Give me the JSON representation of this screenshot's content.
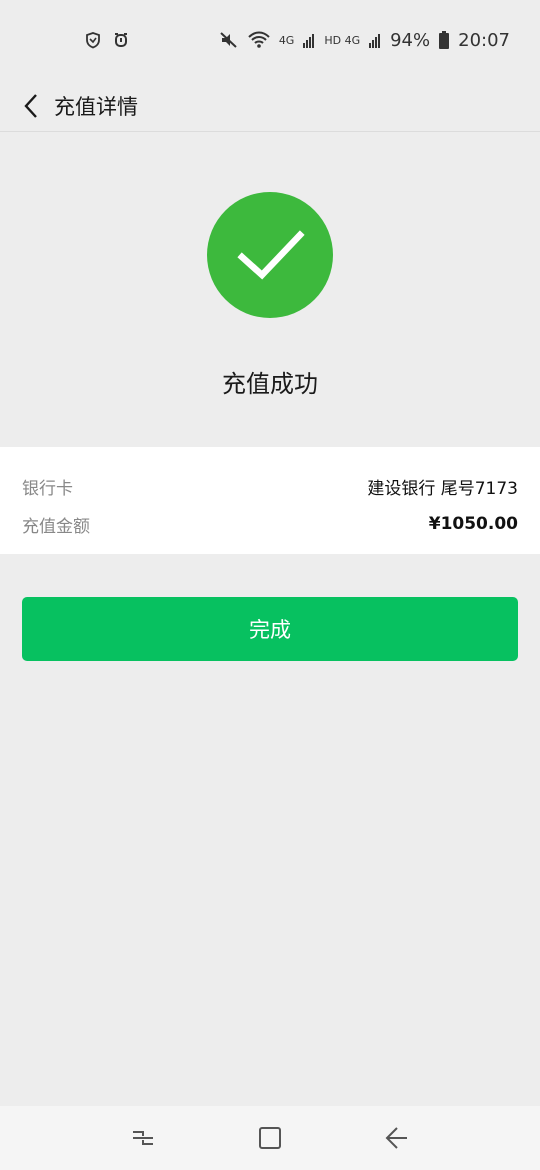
{
  "status_bar": {
    "battery": "94%",
    "time": "20:07",
    "network_a": "4G",
    "network_b": "HD 4G",
    "icons": [
      "shield-icon",
      "alarm-icon",
      "mute-icon",
      "wifi-icon",
      "signal-icon",
      "battery-icon"
    ]
  },
  "header": {
    "title": "充值详情"
  },
  "result": {
    "status_text": "充值成功",
    "icon": "checkmark-icon",
    "color": "#3db93d"
  },
  "details": {
    "rows": [
      {
        "label": "银行卡",
        "value": "建设银行 尾号7173"
      },
      {
        "label": "充值金额",
        "value": "¥1050.00"
      }
    ]
  },
  "actions": {
    "done_label": "完成",
    "color": "#07c160"
  },
  "system_nav": {
    "icons": [
      "recent-apps-icon",
      "home-icon",
      "back-icon"
    ]
  }
}
